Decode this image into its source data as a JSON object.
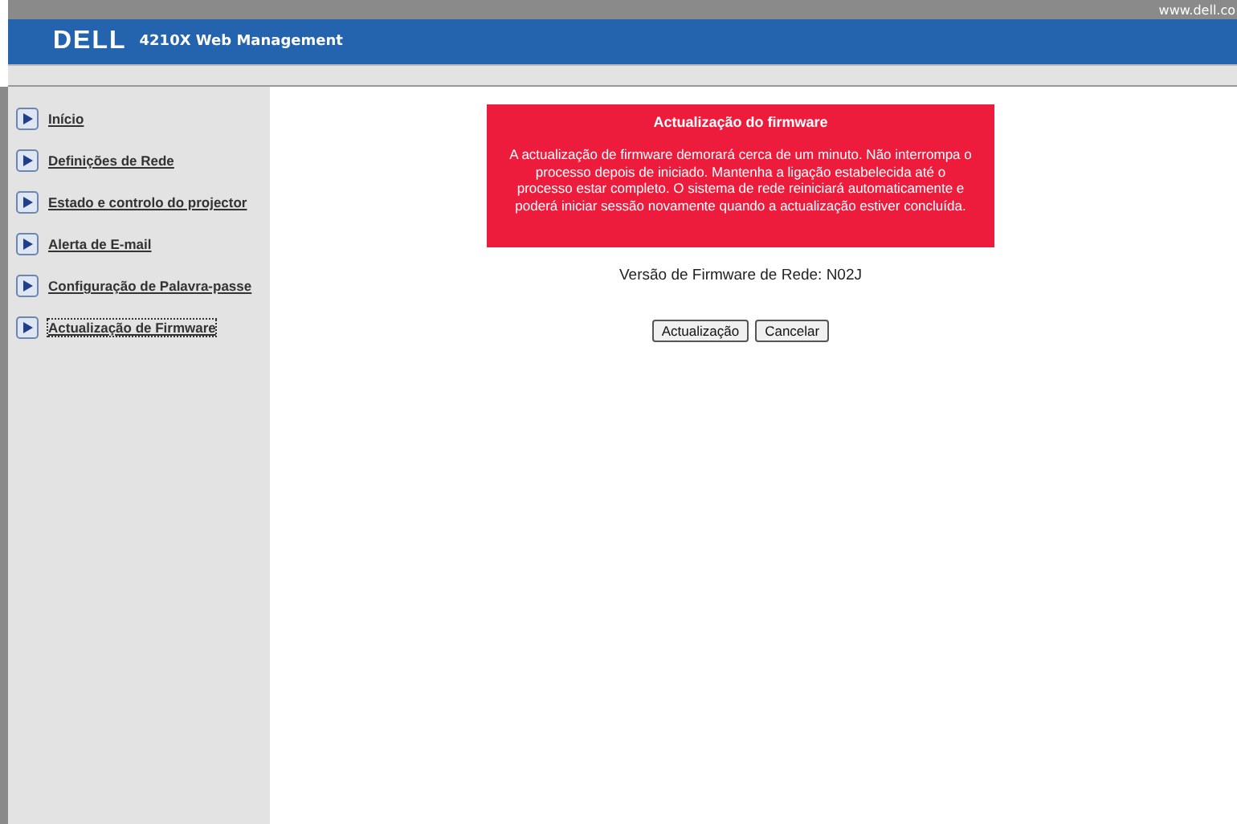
{
  "top_bar": {
    "link": "www.dell.co"
  },
  "header": {
    "logo": "DELL",
    "title": "4210X Web Management"
  },
  "sidebar": {
    "items": [
      {
        "label": "Início",
        "selected": false
      },
      {
        "label": "Definições de Rede",
        "selected": false
      },
      {
        "label": "Estado e controlo do projector",
        "selected": false
      },
      {
        "label": "Alerta de E-mail",
        "selected": false
      },
      {
        "label": "Configuração de Palavra-passe",
        "selected": false
      },
      {
        "label": "Actualização de Firmware",
        "selected": true
      }
    ]
  },
  "notice": {
    "title": "Actualização do firmware",
    "text": "A actualização de firmware demorará cerca de um minuto. Não interrompa o processo depois de iniciado. Mantenha a ligação estabelecida até o processo estar completo. O sistema de rede reiniciará automaticamente e poderá iniciar sessão novamente quando a actualização estiver concluída."
  },
  "version": "Versão de Firmware de Rede: N02J",
  "buttons": [
    "Actualização",
    "Cancelar"
  ]
}
